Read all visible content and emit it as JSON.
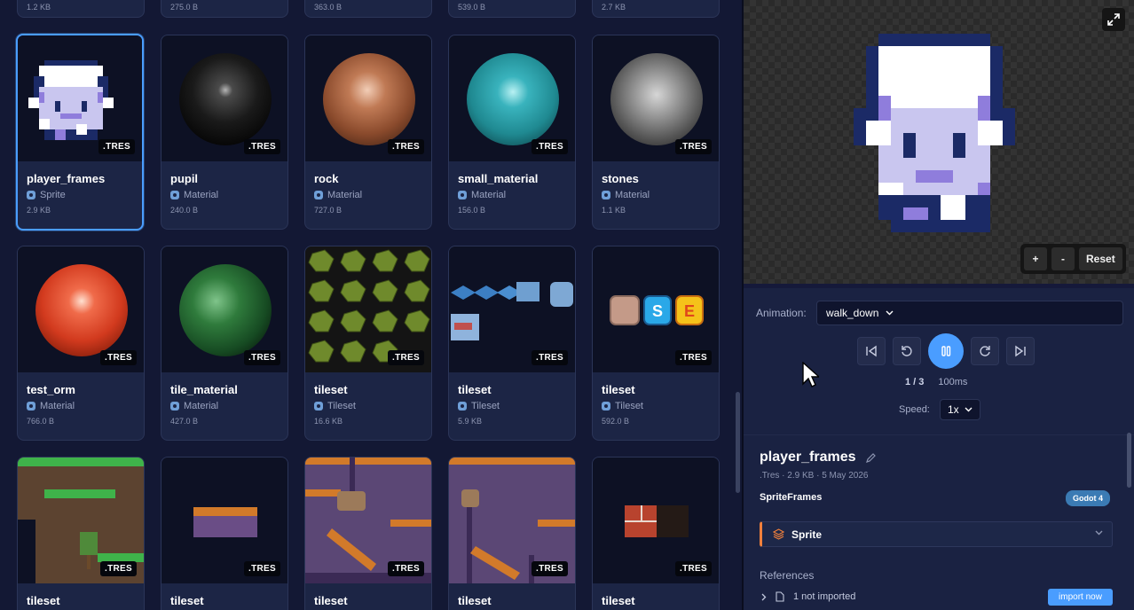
{
  "top_row_sizes": [
    "1.2 KB",
    "275.0 B",
    "363.0 B",
    "539.0 B",
    "2.7 KB"
  ],
  "cards": [
    {
      "name": "player_frames",
      "type": "Sprite",
      "size": "2.9 KB",
      "badge": ".TRES",
      "thumb": "pixel-character",
      "selected": true
    },
    {
      "name": "pupil",
      "type": "Material",
      "size": "240.0 B",
      "badge": ".TRES",
      "thumb": "black-sphere"
    },
    {
      "name": "rock",
      "type": "Material",
      "size": "727.0 B",
      "badge": ".TRES",
      "thumb": "rock-sphere"
    },
    {
      "name": "small_material",
      "type": "Material",
      "size": "156.0 B",
      "badge": ".TRES",
      "thumb": "teal-sphere"
    },
    {
      "name": "stones",
      "type": "Material",
      "size": "1.1 KB",
      "badge": ".TRES",
      "thumb": "stone-sphere"
    },
    {
      "name": "test_orm",
      "type": "Material",
      "size": "766.0 B",
      "badge": ".TRES",
      "thumb": "red-sphere"
    },
    {
      "name": "tile_material",
      "type": "Material",
      "size": "427.0 B",
      "badge": ".TRES",
      "thumb": "green-sphere"
    },
    {
      "name": "tileset",
      "type": "Tileset",
      "size": "16.6 KB",
      "badge": ".TRES",
      "thumb": "hex-tiles"
    },
    {
      "name": "tileset",
      "type": "Tileset",
      "size": "5.9 KB",
      "badge": ".TRES",
      "thumb": "iso-blocks"
    },
    {
      "name": "tileset",
      "type": "Tileset",
      "size": "592.0 B",
      "badge": ".TRES",
      "thumb": "letter-tiles"
    },
    {
      "name": "tileset",
      "badge": ".TRES",
      "thumb": "grass-platformer"
    },
    {
      "name": "tileset",
      "badge": ".TRES",
      "thumb": "small-platform"
    },
    {
      "name": "tileset",
      "badge": ".TRES",
      "thumb": "purple-platformer"
    },
    {
      "name": "tileset",
      "badge": ".TRES",
      "thumb": "purple-platformer"
    },
    {
      "name": "tileset",
      "badge": ".TRES",
      "thumb": "brick-block"
    }
  ],
  "preview": {
    "zoom_in": "+",
    "zoom_out": "-",
    "reset": "Reset"
  },
  "animation": {
    "label": "Animation:",
    "selected": "walk_down",
    "frame": "1 / 3",
    "duration": "100ms",
    "speed_label": "Speed:",
    "speed": "1x"
  },
  "details": {
    "title": "player_frames",
    "meta": ".Tres · 2.9 KB · 5 May 2026",
    "kind": "SpriteFrames",
    "engine": "Godot 4",
    "section": "Sprite",
    "references_label": "References",
    "not_imported": "1 not imported",
    "import_button": "import now"
  },
  "colors": {
    "accent": "#4a9dff",
    "background": "#131834",
    "card": "#1c2545",
    "sprite_accent": "#f0803c"
  }
}
